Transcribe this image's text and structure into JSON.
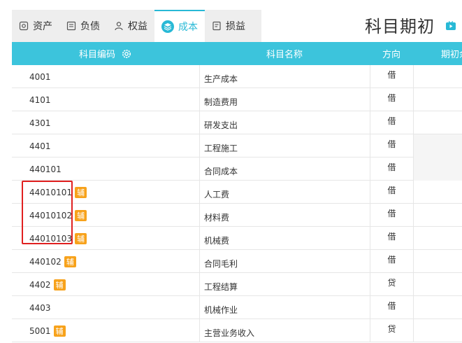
{
  "tabs": [
    {
      "label": "资产",
      "icon": "safe-icon",
      "active": false
    },
    {
      "label": "负债",
      "icon": "ledger-icon",
      "active": false
    },
    {
      "label": "权益",
      "icon": "person-icon",
      "active": false
    },
    {
      "label": "成本",
      "icon": "layers-icon",
      "active": true
    },
    {
      "label": "损益",
      "icon": "report-icon",
      "active": false
    }
  ],
  "page_title": "科目期初",
  "table": {
    "headers": {
      "code": "科目编码",
      "name": "科目名称",
      "direction": "方向",
      "balance": "期初余额"
    },
    "aux_badge": "辅",
    "rows": [
      {
        "code": "4001",
        "name": "生产成本",
        "direction": "借",
        "aux": false
      },
      {
        "code": "4101",
        "name": "制造费用",
        "direction": "借",
        "aux": false
      },
      {
        "code": "4301",
        "name": "研发支出",
        "direction": "借",
        "aux": false
      },
      {
        "code": "4401",
        "name": "工程施工",
        "direction": "借",
        "aux": false
      },
      {
        "code": "440101",
        "name": "合同成本",
        "direction": "借",
        "aux": false
      },
      {
        "code": "44010101",
        "name": "人工费",
        "direction": "借",
        "aux": true
      },
      {
        "code": "44010102",
        "name": "材料费",
        "direction": "借",
        "aux": true
      },
      {
        "code": "44010103",
        "name": "机械费",
        "direction": "借",
        "aux": true
      },
      {
        "code": "440102",
        "name": "合同毛利",
        "direction": "借",
        "aux": true
      },
      {
        "code": "4402",
        "name": "工程结算",
        "direction": "贷",
        "aux": true
      },
      {
        "code": "4403",
        "name": "机械作业",
        "direction": "借",
        "aux": false
      },
      {
        "code": "5001",
        "name": "主营业务收入",
        "direction": "贷",
        "aux": true
      }
    ]
  },
  "colors": {
    "accent": "#3cc4dc",
    "tab_active": "#28b9d6",
    "badge": "#f7a21b",
    "highlight": "#e02020"
  }
}
